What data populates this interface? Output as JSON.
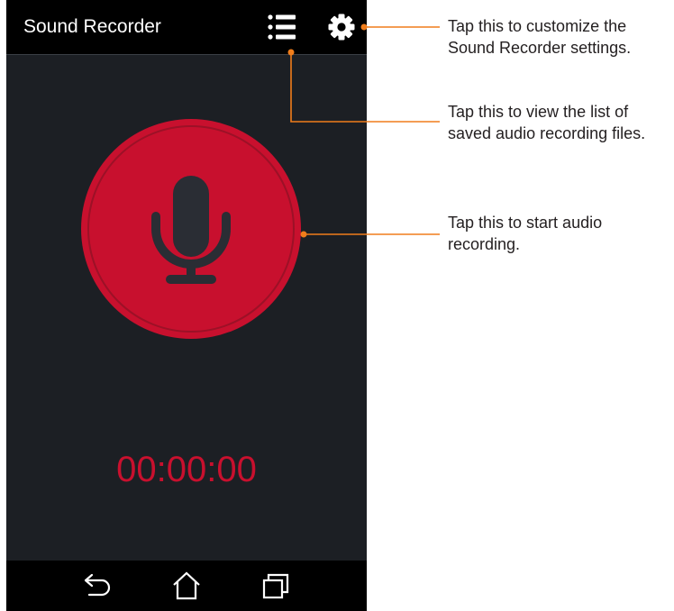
{
  "app": {
    "title": "Sound Recorder"
  },
  "toolbar": {
    "list_icon": "list-icon",
    "settings_icon": "gear-icon"
  },
  "record": {
    "icon": "microphone-icon",
    "timer": "00:00:00"
  },
  "navigation": {
    "back_icon": "back-arrow-icon",
    "home_icon": "home-icon",
    "recents_icon": "recent-apps-icon"
  },
  "callouts": [
    {
      "text": "Tap this to customize the Sound Recorder settings."
    },
    {
      "text": "Tap this to view the list of saved audio recording files."
    },
    {
      "text": "Tap this to start audio recording."
    }
  ],
  "colors": {
    "screen_background": "#1c1f24",
    "bar_background": "#000000",
    "record_red": "#c8102e",
    "leader_orange": "#f07d1b",
    "callout_text": "#231f20"
  }
}
